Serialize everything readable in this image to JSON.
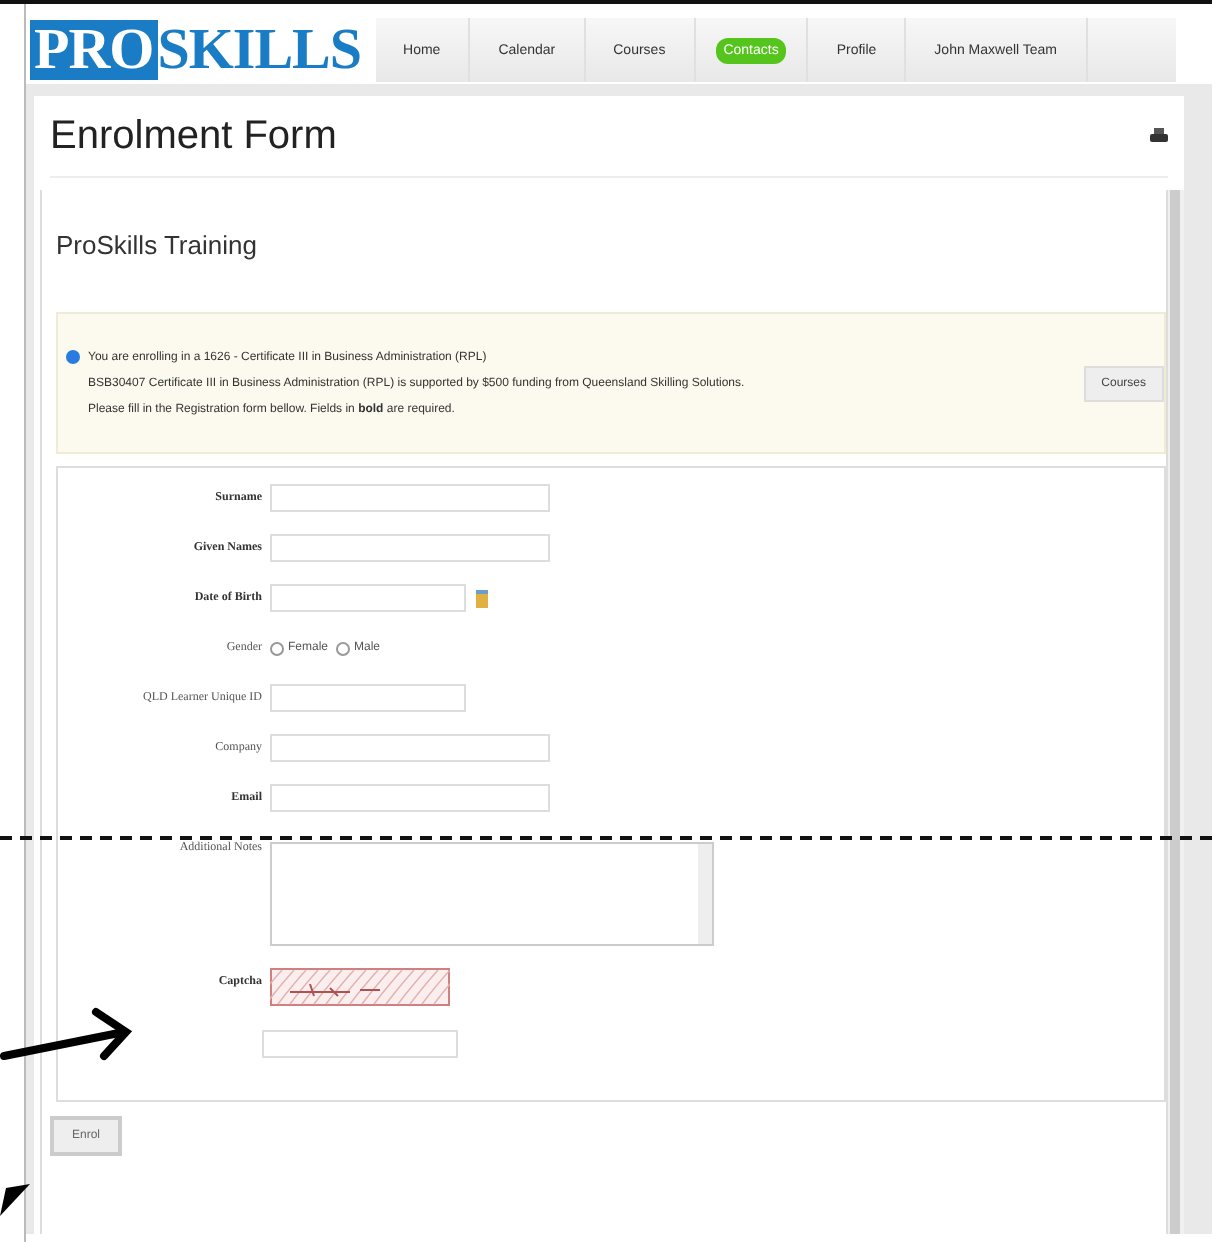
{
  "logo": {
    "part_1": "PRO",
    "part_2": "SKILLS"
  },
  "nav": [
    {
      "label": "Home",
      "selected": false
    },
    {
      "label": "Calendar",
      "selected": false
    },
    {
      "label": "Courses",
      "selected": false
    },
    {
      "label": "Contacts",
      "selected": true
    },
    {
      "label": "Profile",
      "selected": false
    },
    {
      "label": "John Maxwell Team",
      "selected": false
    }
  ],
  "page_title": "Enrolment Form",
  "section_title": "ProSkills Training",
  "info": {
    "lines": [
      "You are enrolling in a 1626 - Certificate III in Business Administration (RPL)",
      "BSB30407 Certificate III in Business Administration (RPL) is supported by $500 funding from Queensland Skilling Solutions.",
      "Please fill in the Registration form bellow. Fields in **bold** are required."
    ],
    "button": "Courses"
  },
  "fields": [
    {
      "kind": "text",
      "label": "Surname",
      "required": true
    },
    {
      "kind": "text",
      "label": "Given Names",
      "required": true
    },
    {
      "kind": "date",
      "label": "Date of Birth",
      "required": true
    },
    {
      "kind": "radio",
      "label": "Gender",
      "required": false,
      "options": [
        {
          "label": "Female",
          "selected": false
        },
        {
          "label": "Male",
          "selected": false
        }
      ]
    },
    {
      "kind": "short",
      "label": "QLD Learner Unique ID",
      "required": false
    },
    {
      "kind": "text",
      "label": "Company",
      "required": false
    },
    {
      "kind": "text",
      "label": "Email",
      "required": true
    },
    {
      "kind": "textarea",
      "label": "Additional Notes",
      "required": false
    },
    {
      "kind": "captcha",
      "label": "Captcha",
      "required": true
    }
  ],
  "submit": "Enrol"
}
